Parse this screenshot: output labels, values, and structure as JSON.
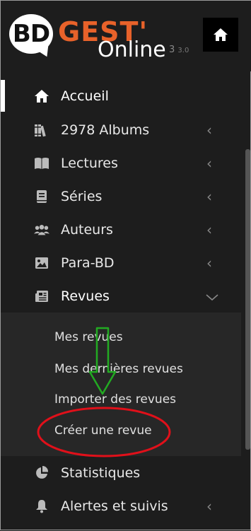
{
  "header": {
    "logo_bd": "BD",
    "logo_gest": "GEST'",
    "logo_online": "Online",
    "version_major": "3",
    "version_full": "3.0",
    "home_button_icon": "home-icon"
  },
  "nav": {
    "items": [
      {
        "label": "Accueil",
        "icon": "home-icon"
      },
      {
        "label": "2978 Albums",
        "icon": "books-icon"
      },
      {
        "label": "Lectures",
        "icon": "open-book-icon"
      },
      {
        "label": "Séries",
        "icon": "book-icon"
      },
      {
        "label": "Auteurs",
        "icon": "users-icon"
      },
      {
        "label": "Para-BD",
        "icon": "image-icon"
      },
      {
        "label": "Revues",
        "icon": "newspaper-icon"
      },
      {
        "label": "Statistiques",
        "icon": "pie-chart-icon"
      },
      {
        "label": "Alertes et suivis",
        "icon": "bell-icon"
      }
    ],
    "revues_sub": [
      "Mes revues",
      "Mes dernières revues",
      "Importer des revues",
      "Créer une revue"
    ]
  },
  "colors": {
    "background": "#1d1d1d",
    "submenu_background": "#272727",
    "brand_orange": "#e8622a",
    "annotation_red": "#e0101a",
    "annotation_green": "#22aa22"
  }
}
